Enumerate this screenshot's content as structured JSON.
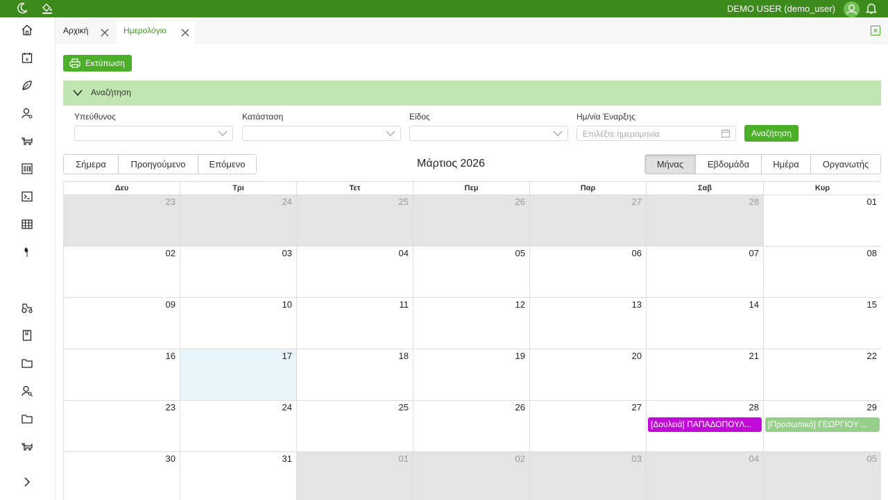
{
  "header": {
    "user": "DEMO USER (demo_user)"
  },
  "tabs": [
    {
      "label": "Αρχική",
      "active": false
    },
    {
      "label": "Ημερολόγιο",
      "active": true
    }
  ],
  "toolbar": {
    "print_label": "Εκτύπωση"
  },
  "search": {
    "title": "Αναζήτηση",
    "fields": [
      {
        "label": "Υπεύθυνος",
        "value": ""
      },
      {
        "label": "Κατάσταση",
        "value": ""
      },
      {
        "label": "Είδος",
        "value": ""
      },
      {
        "label": "Ημ/νία Έναρξης",
        "placeholder": "Επιλέξτε ημερομηνία"
      }
    ],
    "button": "Αναζήτηση"
  },
  "nav": {
    "today": "Σήμερα",
    "prev": "Προηγούμενο",
    "next": "Επόμενο"
  },
  "calendar": {
    "title": "Μάρτιος 2026",
    "views": [
      {
        "label": "Μήνας",
        "active": true
      },
      {
        "label": "Εβδομάδα",
        "active": false
      },
      {
        "label": "Ημέρα",
        "active": false
      },
      {
        "label": "Οργανωτής",
        "active": false
      }
    ],
    "weekdays": [
      "Δευ",
      "Τρι",
      "Τετ",
      "Πεμ",
      "Παρ",
      "Σαβ",
      "Κυρ"
    ],
    "weeks": [
      [
        "23",
        "24",
        "25",
        "26",
        "27",
        "28",
        "01"
      ],
      [
        "02",
        "03",
        "04",
        "05",
        "06",
        "07",
        "08"
      ],
      [
        "09",
        "10",
        "11",
        "12",
        "13",
        "14",
        "15"
      ],
      [
        "16",
        "17",
        "18",
        "19",
        "20",
        "21",
        "22"
      ],
      [
        "23",
        "24",
        "25",
        "26",
        "27",
        "28",
        "29"
      ],
      [
        "30",
        "31",
        "01",
        "02",
        "03",
        "04",
        "05"
      ]
    ],
    "today": "17",
    "events": [
      {
        "text": "[Δουλειά] ΠΑΠΑΔΟΠΟΥΛ...",
        "color": "#c30bd9"
      },
      {
        "text": "[Προσωπικό] ΓΕΩΡΓΙΟΥ ...",
        "color": "#96cf89"
      }
    ]
  },
  "colors": {
    "topbar": "#3d8a1c",
    "accent": "#4caf2a",
    "search_bar": "#c1e6b2",
    "today_cell": "#e8f4fc"
  }
}
